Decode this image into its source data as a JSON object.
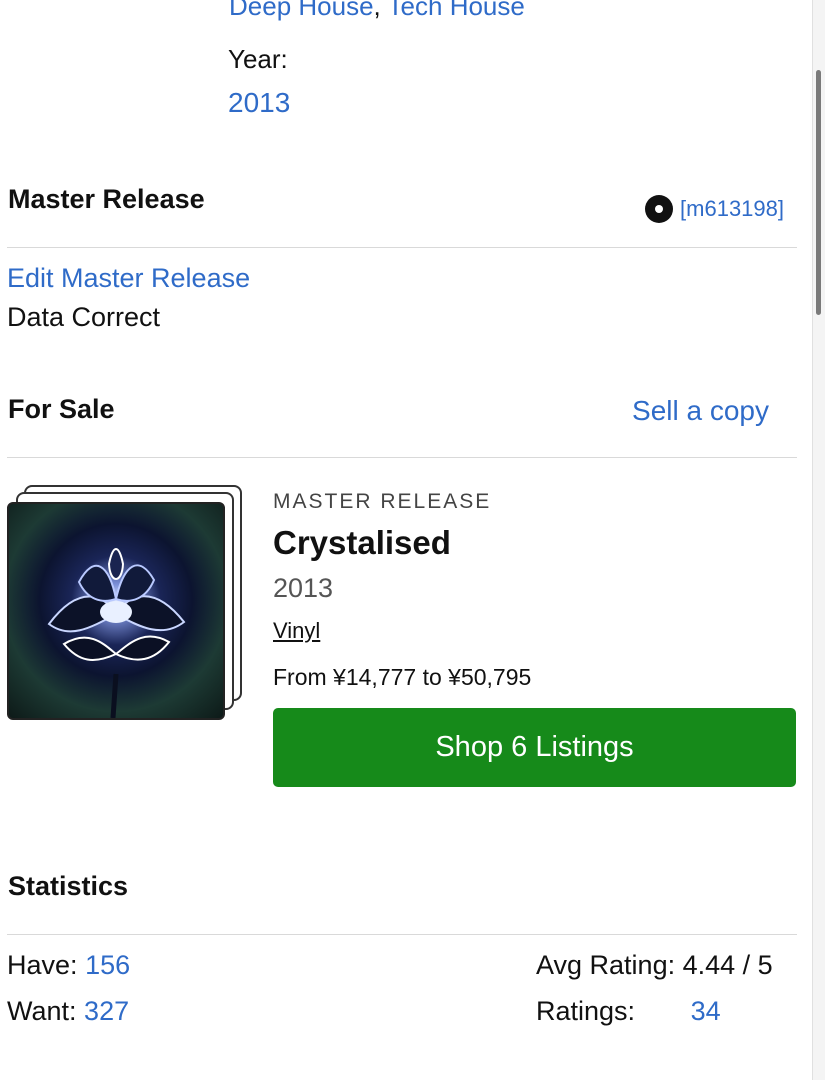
{
  "release_meta": {
    "genres": [
      "Deep House",
      "Tech House"
    ],
    "genre_separator": ",",
    "year_label": "Year:",
    "year_value": "2013"
  },
  "master_release": {
    "heading": "Master Release",
    "id": "[m613198]",
    "edit_link": "Edit Master Release",
    "data_status": "Data Correct",
    "icon": "vinyl-disc-icon"
  },
  "for_sale": {
    "heading": "For Sale",
    "sell_link": "Sell a copy",
    "card": {
      "type_label": "MASTER RELEASE",
      "title": "Crystalised",
      "year": "2013",
      "format": "Vinyl",
      "price_range": "From ¥14,777 to ¥50,795",
      "shop_button": "Shop 6 Listings"
    }
  },
  "statistics": {
    "heading": "Statistics",
    "have_label": "Have:",
    "have_value": "156",
    "want_label": "Want:",
    "want_value": "327",
    "avg_rating_label": "Avg Rating:",
    "avg_rating_value": "4.44 / 5",
    "ratings_label": "Ratings:",
    "ratings_value": "34"
  },
  "colors": {
    "link": "#2f6bc8",
    "button": "#168a1a"
  }
}
